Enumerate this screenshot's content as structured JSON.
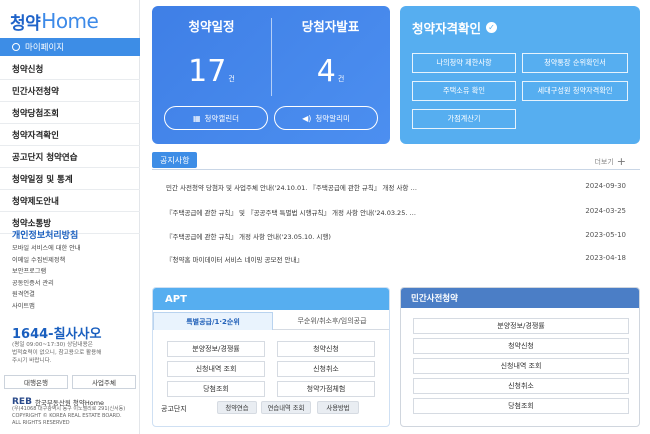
{
  "sidebar": {
    "logo_ko": "청약",
    "logo_en": "Home",
    "mypage": "마이페이지",
    "menu": [
      "청약신청",
      "민간사전청약",
      "청약당첨조회",
      "청약자격확인",
      "공고단지 청약연습",
      "청약일정 및 통계",
      "청약제도안내",
      "청약소통방"
    ],
    "privacy_title": "개인정보처리방침",
    "links": [
      "모바일 서비스에 대한 안내",
      "이메일 수집빈제정책",
      "보안프로그램",
      "공동인증서 관리",
      "원격연결",
      "사이트맵"
    ],
    "phone": "1644-칠사사오",
    "hours_1": "(평일 09:00~17:30) 상담내용은",
    "hours_2": "법적효력이 없으니, 참고용으로 활용해",
    "hours_3": "주시기 바랍니다.",
    "footer_btn_1": "대행은행",
    "footer_btn_2": "사업주체",
    "org_logo": "REB",
    "org_name": "한국부동산원 청약Home",
    "addr_1": "(우)41068 대구광역시 동구 이노밸리로 291(신서동)",
    "addr_2": "COPYRIGHT © KOREA REAL ESTATE BOARD.",
    "addr_3": "ALL RIGHTS RESERVED"
  },
  "schedule": {
    "title_1": "청약일정",
    "count_1": "17",
    "title_2": "당첨자발표",
    "count_2": "4",
    "unit": "건",
    "btn_1": "청약캘린더",
    "btn_2": "청약알리미"
  },
  "qualify": {
    "title": "청약자격확인",
    "btns": [
      "나의청약 제한사항",
      "청약통장 순위확인서",
      "주택소유 확인",
      "세대구성원 청약자격확인",
      "가점계산기"
    ]
  },
  "notice": {
    "tab": "공지사항",
    "more": "더보기",
    "items": [
      {
        "title": "민간 사전청약 당첨자 및 사업주체 안내('24.10.01. 『주택공급에 관한 규칙』 개정 사항 …",
        "date": "2024-09-30"
      },
      {
        "title": "『주택공급에 관한 규칙』 및 『공공주택 특별법 시행규칙』 개정 사항 안내('24.03.25. …",
        "date": "2024-03-25"
      },
      {
        "title": "『주택공급에 관한 규칙』 개정 사항 안내('23.05.10. 시행)",
        "date": "2023-05-10"
      },
      {
        "title": "『청약홈 마이데이터 서비스 네이밍 공모전 안내』",
        "date": "2023-04-18"
      }
    ]
  },
  "apt": {
    "title": "APT",
    "tab_1": "특별공급/1·2순위",
    "tab_2": "무순위/취소후/임의공급",
    "btns": [
      "분양정보/경쟁률",
      "청약신청",
      "신청내역 조회",
      "신청취소",
      "당첨조회",
      "청약가점체험"
    ],
    "gong": "공고단지",
    "small": [
      "청약연습",
      "연습내역 조회",
      "사용방법"
    ]
  },
  "private": {
    "title": "민간사전청약",
    "btns": [
      "분양정보/경쟁률",
      "청약신청",
      "신청내역 조회",
      "신청취소",
      "당첨조회"
    ]
  }
}
